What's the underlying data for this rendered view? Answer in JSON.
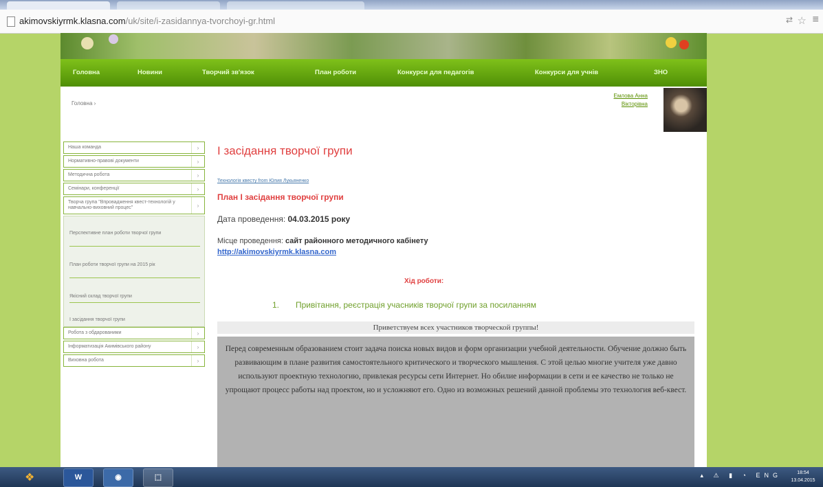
{
  "browser": {
    "url_host": "akimovskiyrmk.klasna.com",
    "url_path": "/uk/site/i-zasidannya-tvorchoyi-gr.html"
  },
  "nav": {
    "items": [
      "Головна",
      "Новини",
      "Творчий зв'язок",
      "План роботи",
      "Конкурси для педагогів",
      "Конкурси для учнів",
      "ЗНО"
    ]
  },
  "breadcrumb": "Головна ›",
  "author": {
    "line1": "Емлова Анна",
    "line2": "Вікторівна"
  },
  "sidebar": {
    "items": [
      {
        "label": "Наша команда"
      },
      {
        "label": "Нормативно-правові документи"
      },
      {
        "label": "Методична робота"
      },
      {
        "label": "Семінари, конференції"
      },
      {
        "label": "Творча група \"Впровадження квест-технологій у навчально-виховний процес\""
      }
    ],
    "subitems": [
      "Перспективне план роботи творчої групи",
      "План роботи творчої групи на 2015 рік",
      "Якісний склад творчої групи",
      "І засідання творчої групи"
    ],
    "items_after": [
      {
        "label": "Робота з обдарованими"
      },
      {
        "label": "Інформатизація Акимівського району"
      },
      {
        "label": "Виховна робота"
      }
    ]
  },
  "content": {
    "title": "І засідання творчої групи",
    "tag_line": "Технологія квесту from Юлия Лукьяненко",
    "plan_title": "План І засідання творчої групи",
    "date_label": "Дата проведення: ",
    "date_value": "04.03.2015 року",
    "place_label": "Місце проведення: ",
    "place_value": "сайт районного методичного кабінету",
    "place_link": "http://akimovskiyrmk.klasna.com",
    "progress_heading": "Хід роботи:",
    "step_num": "1.",
    "step_text": "Привітання, реєстрація учасників творчої групи за посиланням",
    "greeting": "Приветствуем всех участников творческой группы!",
    "paragraph": "Перед современным образованием стоит задача поиска новых видов и форм организации учебной деятельности. Обучение должно быть развивающим в плане развития самостоятельного критического и творческого мышления. С этой целью многие учителя уже давно используют проектную технологию, привлекая ресурсы сети Интернет. Но обилие информации в сети и ее качество не только не упрощают процесс работы над проектом, но и усложняют его. Одно из возможных решений данной проблемы это технология веб-квест."
  },
  "taskbar": {
    "word_label": "W",
    "chrome_label": "◉",
    "app_label": "⬚",
    "lang": "ENG",
    "time": "18:54",
    "date": "13.04.2015"
  }
}
